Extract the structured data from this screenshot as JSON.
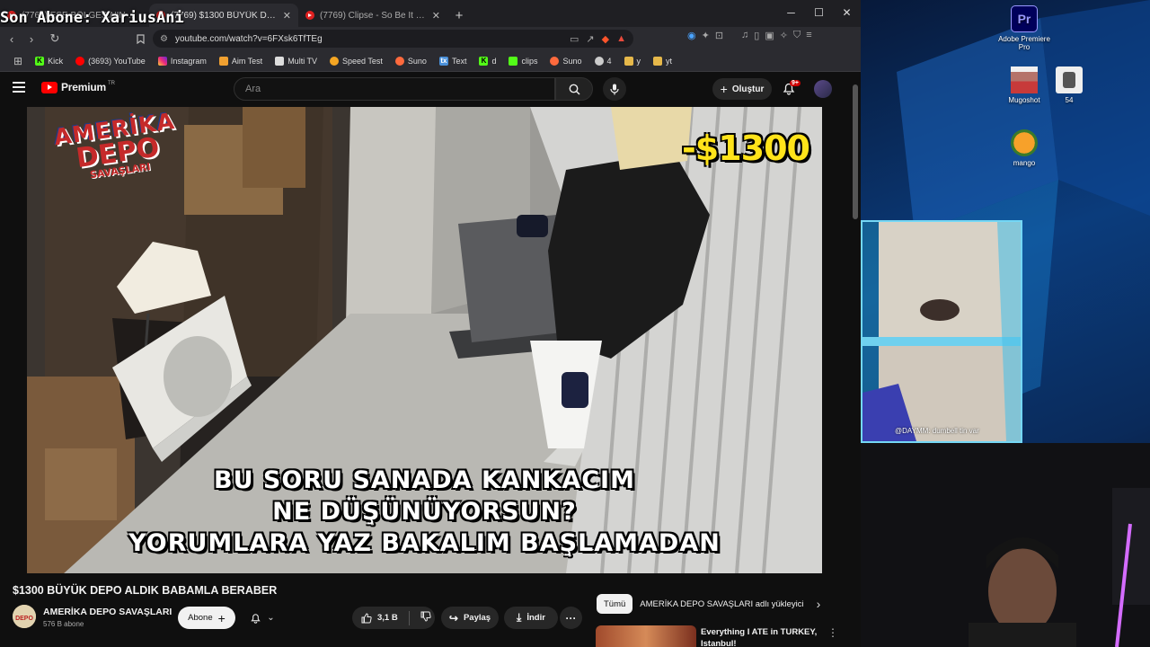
{
  "browser": {
    "tabs": [
      {
        "title": "(7769) ESE BÖLGESİNİN EN DÜŞÜK..."
      },
      {
        "title": "(7769) $1300 BÜYÜK DEPO ALDIK..."
      },
      {
        "title": "(7769) Clipse - So Be It (Official Music..."
      }
    ],
    "address": "youtube.com/watch?v=6FXsk6TfTEg",
    "bookmarks": [
      {
        "label": "Kick",
        "color": "#53fc18"
      },
      {
        "label": "(3693) YouTube",
        "color": "#ff0000"
      },
      {
        "label": "Instagram",
        "color": "#e1306c"
      },
      {
        "label": "Aim Test",
        "color": "#f0a030"
      },
      {
        "label": "Multi TV",
        "color": "#dddddd"
      },
      {
        "label": "Speed Test",
        "color": "#f5a623"
      },
      {
        "label": "Suno",
        "color": "#ff6a3d"
      },
      {
        "label": "Text",
        "color": "#4a90d9"
      },
      {
        "label": "d",
        "color": "#53fc18"
      },
      {
        "label": "clips",
        "color": "#53fc18"
      },
      {
        "label": "Suno",
        "color": "#ff6a3d"
      },
      {
        "label": "4",
        "color": "#cccccc"
      },
      {
        "label": "y",
        "color": "#e6b84a"
      },
      {
        "label": "yt",
        "color": "#e6b84a"
      }
    ]
  },
  "overlay": {
    "subscriber_banner": "Son Abone: XariusAni"
  },
  "youtube": {
    "brand": "Premium",
    "brand_region": "TR",
    "search_placeholder": "Ara",
    "create_label": "Oluştur",
    "notifications": "9+",
    "video": {
      "title": "$1300 BÜYÜK DEPO ALDIK BABAMLA BERABER",
      "overlay_logo_line1": "AMERİKA",
      "overlay_logo_line2": "DEPO",
      "overlay_logo_line3": "SAVAŞLARI",
      "price_tag": "-$1300",
      "caption_line1": "BU SORU SANADA KANKACIM",
      "caption_line2": "NE DÜŞÜNÜYORSUN?",
      "caption_line3": "YORUMLARA YAZ BAKALIM BAŞLAMADAN"
    },
    "channel": {
      "name": "AMERİKA DEPO SAVAŞLARI",
      "subscribers": "576 B abone",
      "subscribe_label": "Abone"
    },
    "actions": {
      "likes": "3,1 B",
      "share_label": "Paylaş",
      "download_label": "İndir"
    },
    "chips": [
      "Tümü",
      "AMERİKA DEPO SAVAŞLARI adlı yükleyici"
    ],
    "recommended": {
      "title": "Everything I ATE in TURKEY, Istanbul!"
    }
  },
  "desktop": {
    "icons": [
      {
        "label": "Adobe Premiere Pro"
      },
      {
        "label": "Mugoshot"
      },
      {
        "label": "54"
      },
      {
        "label": "mango"
      }
    ],
    "chat_message": "@DAYMM: dumbell tin var"
  }
}
